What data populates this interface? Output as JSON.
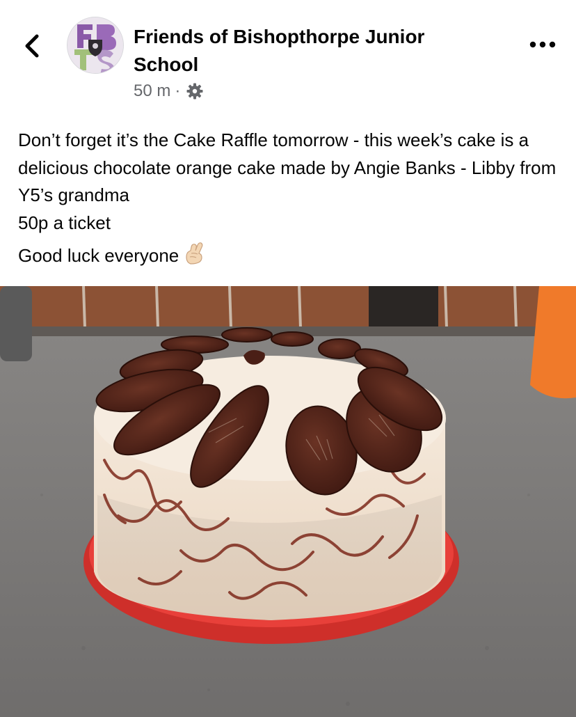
{
  "header": {
    "back_icon": "chevron-left-icon",
    "avatar_icon": "school-logo-avatar",
    "page_name": "Friends of Bishopthorpe Junior School",
    "time_ago": "50 m",
    "separator": "·",
    "audience_icon": "gear-icon",
    "more_icon": "more-horizontal-icon"
  },
  "post": {
    "line1": "Don’t forget it’s the Cake Raffle tomorrow - this week’s cake is a delicious chocolate orange cake made by Angie Banks - Libby from Y5’s grandma",
    "line2": "50p a ticket",
    "line3": "Good luck everyone",
    "emoji_icon": "crossed-fingers-icon"
  },
  "photo": {
    "subject": "cake-photo",
    "colors": {
      "plate": "#e8403a",
      "chocolate": "#4a1f16",
      "frosting": "#f4e8d8",
      "counter": "#7e7c7a"
    }
  },
  "theme": {
    "text": "#050505",
    "secondary_text": "#65676b",
    "background": "#ffffff"
  }
}
